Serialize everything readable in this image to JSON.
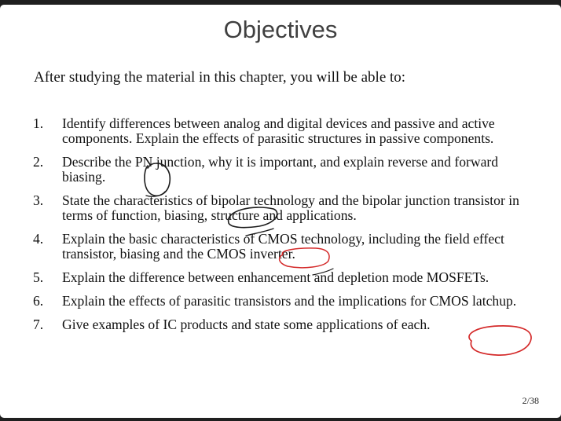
{
  "slide": {
    "title": "Objectives",
    "intro": "After studying the material in this chapter, you will be able to:",
    "objectives": [
      {
        "num": "1.",
        "text": "Identify differences between analog and digital devices and passive and active components. Explain the effects of parasitic structures in passive components."
      },
      {
        "num": "2.",
        "text": "Describe the PN junction, why it is important, and explain reverse and forward biasing."
      },
      {
        "num": "3.",
        "text": "State the characteristics of bipolar technology and the bipolar junction transistor in terms of function, biasing, structure and applications."
      },
      {
        "num": "4.",
        "text": "Explain the basic characteristics of CMOS technology, including the field effect transistor, biasing and the CMOS inverter."
      },
      {
        "num": "5.",
        "text": "Explain the difference between enhancement and depletion mode MOSFETs."
      },
      {
        "num": "6.",
        "text": "Explain the effects of parasitic transistors and the implications for CMOS latchup."
      },
      {
        "num": "7.",
        "text": "Give examples of IC products and state some applications of each."
      }
    ],
    "page_number": "2/38"
  },
  "annotations": {
    "dark_ink_color": "#1b1b1b",
    "red_ink_color": "#d42a2a"
  }
}
